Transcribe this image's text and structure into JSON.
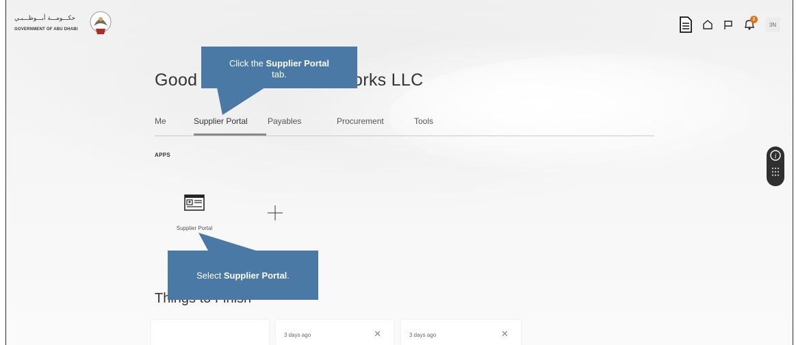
{
  "header": {
    "logo_arabic": "حكـــومـــة أبـــوظـــبـي",
    "logo_english": "GOVERNMENT OF ABU DHABI",
    "notification_count": "2",
    "user_initials": "3N"
  },
  "greeting": {
    "start": "Good a",
    "end": "orks LLC"
  },
  "tabs": [
    {
      "label": "Me"
    },
    {
      "label": "Supplier Portal"
    },
    {
      "label": "Payables"
    },
    {
      "label": "Procurement"
    },
    {
      "label": "Tools"
    }
  ],
  "active_tab": "Supplier Portal",
  "apps": {
    "section_label": "APPS",
    "items": [
      {
        "label": "Supplier Portal",
        "icon": "supplier-portal-icon"
      }
    ]
  },
  "things_to_finish": {
    "title": "Things to Finish",
    "cards": [
      {
        "time": ""
      },
      {
        "time": "3 days ago"
      },
      {
        "time": "3 days ago"
      }
    ]
  },
  "callouts": {
    "tab": {
      "prefix": "Click the ",
      "bold": "Supplier Portal",
      "suffix": " tab."
    },
    "app": {
      "prefix": "Select ",
      "bold": "Supplier Portal",
      "suffix": "."
    }
  },
  "colors": {
    "callout": "#4a79a6",
    "notification_badge": "#e8700f"
  }
}
